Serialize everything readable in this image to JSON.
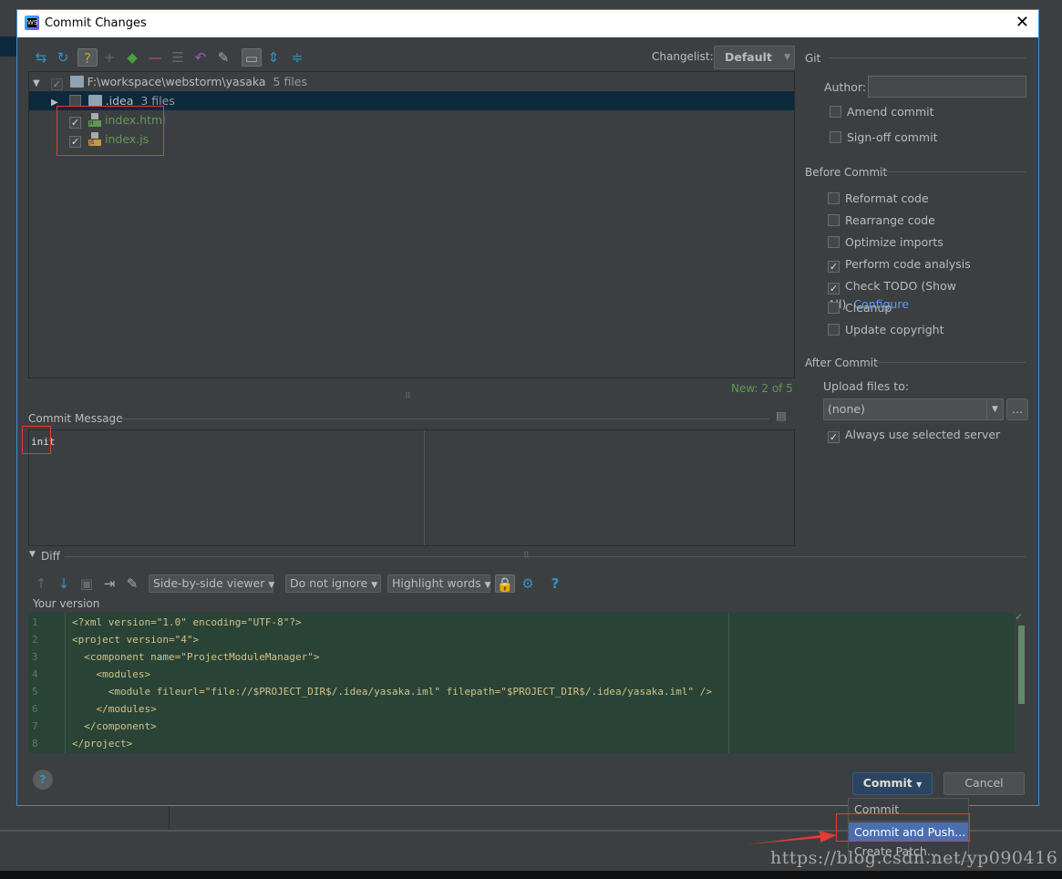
{
  "window": {
    "title": "Commit Changes",
    "close": "✕"
  },
  "toolbar": {
    "icons": [
      "move-icon",
      "refresh-icon",
      "unversioned-icon",
      "add-icon",
      "jump-to-source-icon",
      "remove-icon",
      "select-icon",
      "revert-icon",
      "edit-icon",
      "group-by-directory-icon",
      "expand-all-icon",
      "collapse-all-icon"
    ]
  },
  "changelist": {
    "label": "Changelist:",
    "value": "Default"
  },
  "tree": {
    "root": {
      "path": "F:\\workspace\\webstorm\\yasaka",
      "count": "5 files"
    },
    "folder": {
      "name": ".idea",
      "count": "3 files"
    },
    "files": [
      {
        "name": "index.html",
        "badge": "H",
        "badge_color": "#629755"
      },
      {
        "name": "index.js",
        "badge": "JS",
        "badge_color": "#c49a45"
      }
    ],
    "status": "New: 2 of 5"
  },
  "commit_message": {
    "label": "Commit Message",
    "value": "init"
  },
  "git": {
    "section": "Git",
    "author_label": "Author:",
    "author_value": "",
    "amend": "Amend commit",
    "signoff": "Sign-off commit"
  },
  "before_commit": {
    "section": "Before Commit",
    "options": [
      {
        "label": "Reformat code",
        "checked": false
      },
      {
        "label": "Rearrange code",
        "checked": false
      },
      {
        "label": "Optimize imports",
        "checked": false
      },
      {
        "label": "Perform code analysis",
        "checked": true
      },
      {
        "label": "Check TODO (Show All)",
        "checked": true
      },
      {
        "label": "Cleanup",
        "checked": false
      },
      {
        "label": "Update copyright",
        "checked": false
      }
    ],
    "configure_link": "Configure"
  },
  "after_commit": {
    "section": "After Commit",
    "upload_label": "Upload files to:",
    "upload_value": "(none)",
    "browse": "...",
    "always_use": "Always use selected server"
  },
  "diff": {
    "section": "Diff",
    "viewer": "Side-by-side viewer",
    "ignore": "Do not ignore",
    "highlight": "Highlight words",
    "help": "?",
    "your_version": "Your version",
    "lines": [
      "<?xml version=\"1.0\" encoding=\"UTF-8\"?>",
      "<project version=\"4\">",
      "  <component name=\"ProjectModuleManager\">",
      "    <modules>",
      "      <module fileurl=\"file://$PROJECT_DIR$/.idea/yasaka.iml\" filepath=\"$PROJECT_DIR$/.idea/yasaka.iml\" />",
      "    </modules>",
      "  </component>",
      "</project>"
    ]
  },
  "buttons": {
    "help": "?",
    "commit": "Commit",
    "cancel": "Cancel"
  },
  "commit_menu": {
    "items": [
      "Commit",
      "Commit and Push...",
      "Create Patch..."
    ],
    "highlighted": "Commit and Push..."
  },
  "watermark": "https://blog.csdn.net/yp090416",
  "colors": {
    "accent": "#4b6eaf",
    "selection": "#0d293e",
    "added_bg": "#294436",
    "link": "#589df6",
    "annotation": "#e43a3a"
  }
}
